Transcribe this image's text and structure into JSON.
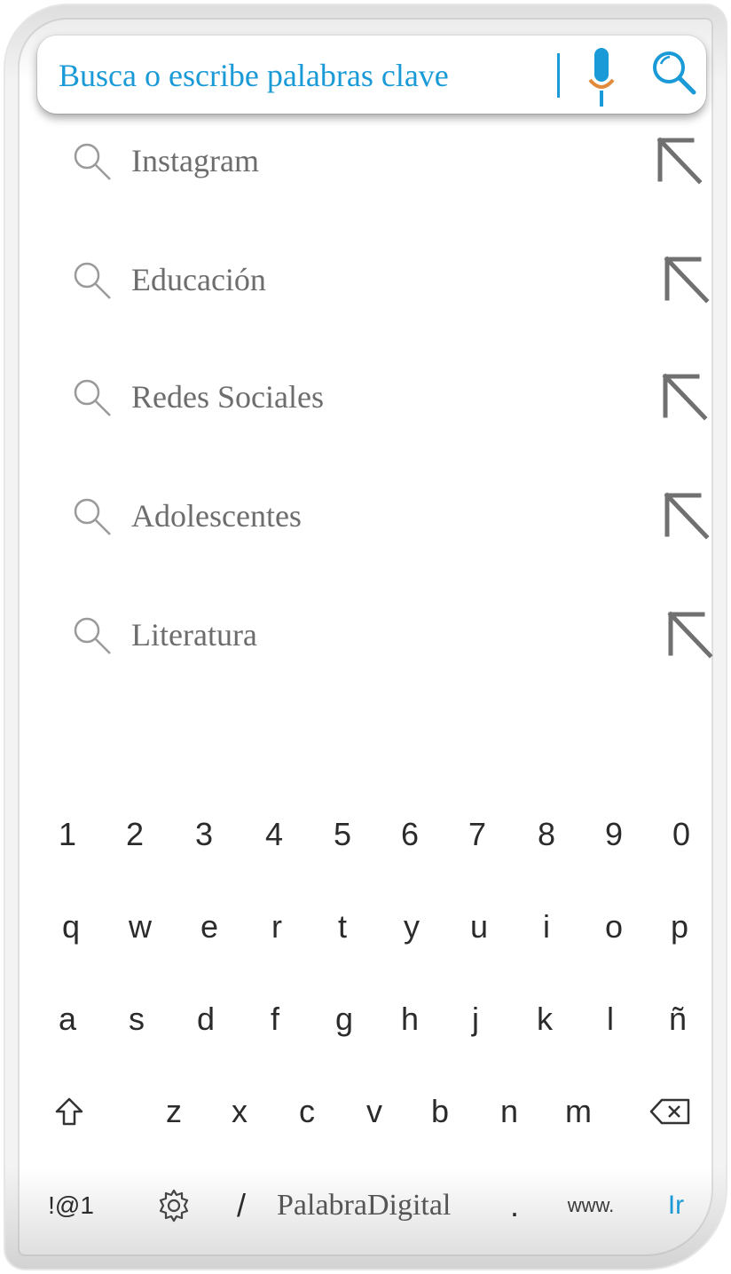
{
  "search": {
    "placeholder": "Busca o escribe palabras clave",
    "mic_icon": "microphone-icon",
    "search_icon": "magnifier-icon"
  },
  "suggestions": [
    {
      "label": "Instagram",
      "icon": "search-icon",
      "action_icon": "arrow-up-left-icon"
    },
    {
      "label": "Educación",
      "icon": "search-icon",
      "action_icon": "arrow-up-left-icon"
    },
    {
      "label": "Redes Sociales",
      "icon": "search-icon",
      "action_icon": "arrow-up-left-icon"
    },
    {
      "label": "Adolescentes",
      "icon": "search-icon",
      "action_icon": "arrow-up-left-icon"
    },
    {
      "label": "Literatura",
      "icon": "search-icon",
      "action_icon": "arrow-up-left-icon"
    }
  ],
  "keyboard": {
    "numbers": [
      "1",
      "2",
      "3",
      "4",
      "5",
      "6",
      "7",
      "8",
      "9",
      "0"
    ],
    "row1": [
      "q",
      "w",
      "e",
      "r",
      "t",
      "y",
      "u",
      "i",
      "o",
      "p"
    ],
    "row2": [
      "a",
      "s",
      "d",
      "f",
      "g",
      "h",
      "j",
      "k",
      "l",
      "ñ"
    ],
    "row3": [
      "z",
      "x",
      "c",
      "v",
      "b",
      "n",
      "m"
    ],
    "bottom": {
      "symbols": "!@1",
      "slash": "/",
      "brand": "PalabraDigital",
      "dot": ".",
      "www": "www.",
      "go": "Ir"
    },
    "shift_icon": "shift-icon",
    "backspace_icon": "backspace-icon",
    "settings_icon": "gear-icon"
  },
  "colors": {
    "accent": "#1a9ad6",
    "mic_orange": "#e08a3c",
    "suggestion_text": "#6d6d6d",
    "key_text": "#2b2b2b"
  }
}
